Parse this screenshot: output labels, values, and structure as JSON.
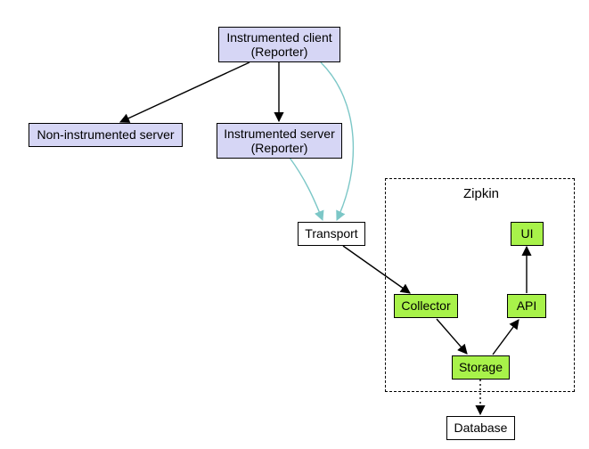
{
  "nodes": {
    "instrumented_client": {
      "line1": "Instrumented client",
      "line2": "(Reporter)"
    },
    "non_instrumented_server": {
      "line1": "Non-instrumented server"
    },
    "instrumented_server": {
      "line1": "Instrumented server",
      "line2": "(Reporter)"
    },
    "transport": {
      "line1": "Transport"
    },
    "collector": {
      "line1": "Collector"
    },
    "api": {
      "line1": "API"
    },
    "ui": {
      "line1": "UI"
    },
    "storage": {
      "line1": "Storage"
    },
    "database": {
      "line1": "Database"
    }
  },
  "group": {
    "zipkin_label": "Zipkin"
  },
  "colors": {
    "lavender": "#d6d6f5",
    "green": "#a8f24a",
    "arrow_black": "#000000",
    "arrow_teal": "#7cc7c7"
  },
  "edges": [
    {
      "from": "instrumented_client",
      "to": "non_instrumented_server",
      "style": "solid",
      "color": "black"
    },
    {
      "from": "instrumented_client",
      "to": "instrumented_server",
      "style": "solid",
      "color": "black"
    },
    {
      "from": "instrumented_client",
      "to": "transport",
      "style": "curve",
      "color": "teal"
    },
    {
      "from": "instrumented_server",
      "to": "transport",
      "style": "curve",
      "color": "teal"
    },
    {
      "from": "transport",
      "to": "collector",
      "style": "solid",
      "color": "black"
    },
    {
      "from": "collector",
      "to": "storage",
      "style": "solid",
      "color": "black"
    },
    {
      "from": "storage",
      "to": "api",
      "style": "solid",
      "color": "black"
    },
    {
      "from": "api",
      "to": "ui",
      "style": "solid",
      "color": "black"
    },
    {
      "from": "storage",
      "to": "database",
      "style": "dotted",
      "color": "black"
    }
  ]
}
